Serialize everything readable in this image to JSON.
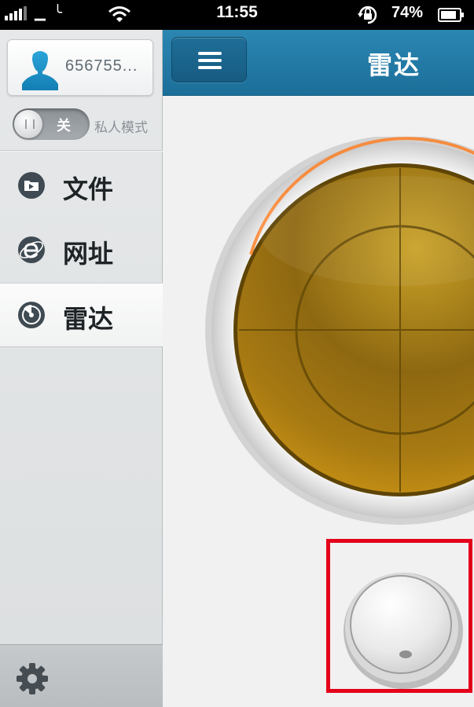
{
  "status_bar": {
    "carrier": "▁ ╰",
    "time": "11:55",
    "battery_percent": "74%",
    "icons": [
      "signal-icon",
      "wifi-icon",
      "rotation-lock-icon",
      "battery-icon"
    ]
  },
  "sidebar": {
    "user": {
      "name": "656755...",
      "icon": "user-avatar-icon"
    },
    "private_mode": {
      "toggle_state": "关",
      "label": "私人模式",
      "on": false
    },
    "items": [
      {
        "label": "文件",
        "icon": "folder-icon",
        "active": false
      },
      {
        "label": "网址",
        "icon": "browser-e-icon",
        "active": false
      },
      {
        "label": "雷达",
        "icon": "radar-icon",
        "active": true
      }
    ],
    "footer": {
      "icon": "gear-icon"
    }
  },
  "topbar": {
    "menu_icon": "hamburger-menu-icon",
    "title": "雷达"
  },
  "colors": {
    "topbar": "#2278a6",
    "radar_gold": "#b88a14",
    "highlight_border": "#e4001b"
  }
}
